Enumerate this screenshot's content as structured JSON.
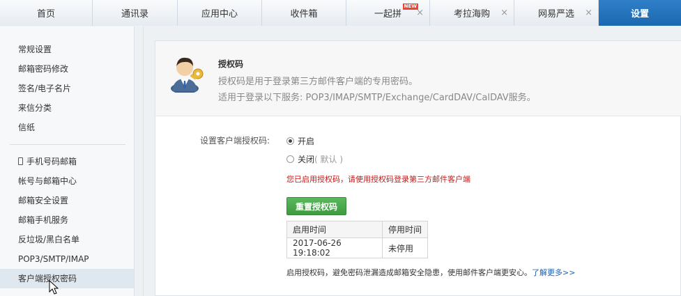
{
  "tabs": [
    {
      "label": "首页"
    },
    {
      "label": "通讯录"
    },
    {
      "label": "应用中心"
    },
    {
      "label": "收件箱"
    },
    {
      "label": "一起拼",
      "badge": "NEW",
      "close": "×"
    },
    {
      "label": "考拉海购",
      "close": "×"
    },
    {
      "label": "网易严选",
      "close": "×"
    },
    {
      "label": "设置"
    }
  ],
  "sidebar": {
    "group1": [
      "常规设置",
      "邮箱密码修改",
      "签名/电子名片",
      "来信分类",
      "信纸"
    ],
    "group2": [
      "手机号码邮箱",
      "帐号与邮箱中心",
      "邮箱安全设置",
      "邮箱手机服务",
      "反垃圾/黑白名单",
      "POP3/SMTP/IMAP",
      "客户端授权密码"
    ]
  },
  "header": {
    "title": "授权码",
    "desc1": "授权码是用于登录第三方邮件客户端的专用密码。",
    "desc2": "适用于登录以下服务: POP3/IMAP/SMTP/Exchange/CardDAV/CalDAV服务。"
  },
  "form": {
    "label": "设置客户端授权码:",
    "option_on": "开启",
    "option_off": "关闭",
    "option_off_note": "( 默认 )",
    "selected": "开启",
    "notice": "您已启用授权码，请使用授权码登录第三方邮件客户端",
    "reset_button": "重置授权码"
  },
  "table": {
    "headers": [
      "启用时间",
      "停用时间"
    ],
    "rows": [
      [
        "2017-06-26 19:18:02",
        "未停用"
      ]
    ]
  },
  "tip": {
    "text": "启用授权码，避免密码泄漏造成邮箱安全隐患，使用邮件客户端更安心。",
    "link": "了解更多>>"
  },
  "colors": {
    "active_tab": "#1c68b0",
    "button_green": "#4cae4c",
    "notice_red": "#c21a1a",
    "link_blue": "#1a5fb4"
  }
}
